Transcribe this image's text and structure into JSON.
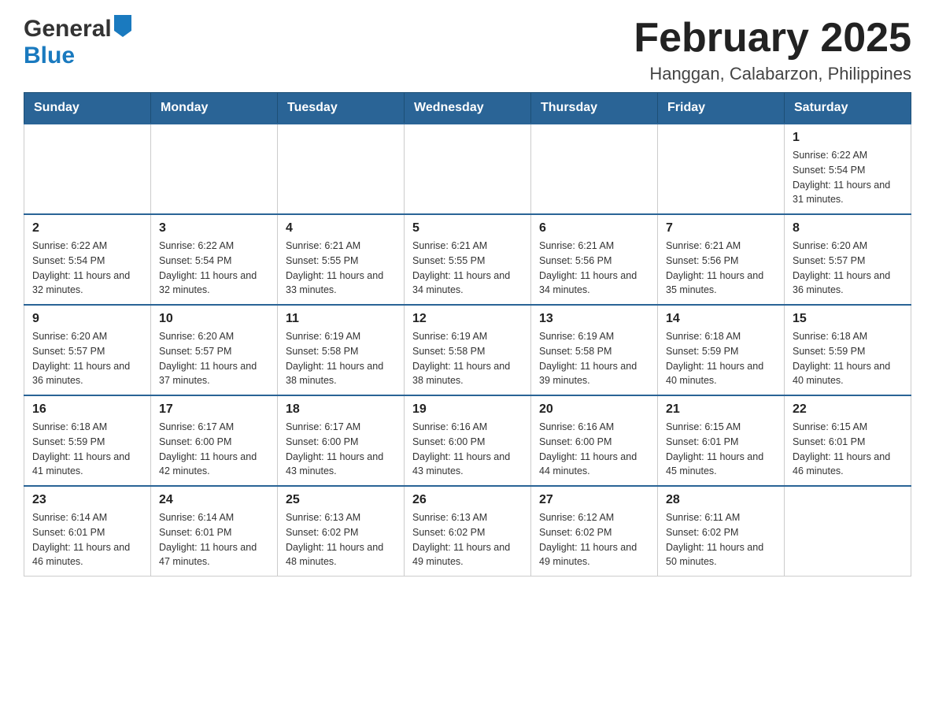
{
  "header": {
    "logo_general": "General",
    "logo_blue": "Blue",
    "month_title": "February 2025",
    "location": "Hanggan, Calabarzon, Philippines"
  },
  "weekdays": [
    "Sunday",
    "Monday",
    "Tuesday",
    "Wednesday",
    "Thursday",
    "Friday",
    "Saturday"
  ],
  "weeks": [
    [
      {
        "day": "",
        "sunrise": "",
        "sunset": "",
        "daylight": ""
      },
      {
        "day": "",
        "sunrise": "",
        "sunset": "",
        "daylight": ""
      },
      {
        "day": "",
        "sunrise": "",
        "sunset": "",
        "daylight": ""
      },
      {
        "day": "",
        "sunrise": "",
        "sunset": "",
        "daylight": ""
      },
      {
        "day": "",
        "sunrise": "",
        "sunset": "",
        "daylight": ""
      },
      {
        "day": "",
        "sunrise": "",
        "sunset": "",
        "daylight": ""
      },
      {
        "day": "1",
        "sunrise": "Sunrise: 6:22 AM",
        "sunset": "Sunset: 5:54 PM",
        "daylight": "Daylight: 11 hours and 31 minutes."
      }
    ],
    [
      {
        "day": "2",
        "sunrise": "Sunrise: 6:22 AM",
        "sunset": "Sunset: 5:54 PM",
        "daylight": "Daylight: 11 hours and 32 minutes."
      },
      {
        "day": "3",
        "sunrise": "Sunrise: 6:22 AM",
        "sunset": "Sunset: 5:54 PM",
        "daylight": "Daylight: 11 hours and 32 minutes."
      },
      {
        "day": "4",
        "sunrise": "Sunrise: 6:21 AM",
        "sunset": "Sunset: 5:55 PM",
        "daylight": "Daylight: 11 hours and 33 minutes."
      },
      {
        "day": "5",
        "sunrise": "Sunrise: 6:21 AM",
        "sunset": "Sunset: 5:55 PM",
        "daylight": "Daylight: 11 hours and 34 minutes."
      },
      {
        "day": "6",
        "sunrise": "Sunrise: 6:21 AM",
        "sunset": "Sunset: 5:56 PM",
        "daylight": "Daylight: 11 hours and 34 minutes."
      },
      {
        "day": "7",
        "sunrise": "Sunrise: 6:21 AM",
        "sunset": "Sunset: 5:56 PM",
        "daylight": "Daylight: 11 hours and 35 minutes."
      },
      {
        "day": "8",
        "sunrise": "Sunrise: 6:20 AM",
        "sunset": "Sunset: 5:57 PM",
        "daylight": "Daylight: 11 hours and 36 minutes."
      }
    ],
    [
      {
        "day": "9",
        "sunrise": "Sunrise: 6:20 AM",
        "sunset": "Sunset: 5:57 PM",
        "daylight": "Daylight: 11 hours and 36 minutes."
      },
      {
        "day": "10",
        "sunrise": "Sunrise: 6:20 AM",
        "sunset": "Sunset: 5:57 PM",
        "daylight": "Daylight: 11 hours and 37 minutes."
      },
      {
        "day": "11",
        "sunrise": "Sunrise: 6:19 AM",
        "sunset": "Sunset: 5:58 PM",
        "daylight": "Daylight: 11 hours and 38 minutes."
      },
      {
        "day": "12",
        "sunrise": "Sunrise: 6:19 AM",
        "sunset": "Sunset: 5:58 PM",
        "daylight": "Daylight: 11 hours and 38 minutes."
      },
      {
        "day": "13",
        "sunrise": "Sunrise: 6:19 AM",
        "sunset": "Sunset: 5:58 PM",
        "daylight": "Daylight: 11 hours and 39 minutes."
      },
      {
        "day": "14",
        "sunrise": "Sunrise: 6:18 AM",
        "sunset": "Sunset: 5:59 PM",
        "daylight": "Daylight: 11 hours and 40 minutes."
      },
      {
        "day": "15",
        "sunrise": "Sunrise: 6:18 AM",
        "sunset": "Sunset: 5:59 PM",
        "daylight": "Daylight: 11 hours and 40 minutes."
      }
    ],
    [
      {
        "day": "16",
        "sunrise": "Sunrise: 6:18 AM",
        "sunset": "Sunset: 5:59 PM",
        "daylight": "Daylight: 11 hours and 41 minutes."
      },
      {
        "day": "17",
        "sunrise": "Sunrise: 6:17 AM",
        "sunset": "Sunset: 6:00 PM",
        "daylight": "Daylight: 11 hours and 42 minutes."
      },
      {
        "day": "18",
        "sunrise": "Sunrise: 6:17 AM",
        "sunset": "Sunset: 6:00 PM",
        "daylight": "Daylight: 11 hours and 43 minutes."
      },
      {
        "day": "19",
        "sunrise": "Sunrise: 6:16 AM",
        "sunset": "Sunset: 6:00 PM",
        "daylight": "Daylight: 11 hours and 43 minutes."
      },
      {
        "day": "20",
        "sunrise": "Sunrise: 6:16 AM",
        "sunset": "Sunset: 6:00 PM",
        "daylight": "Daylight: 11 hours and 44 minutes."
      },
      {
        "day": "21",
        "sunrise": "Sunrise: 6:15 AM",
        "sunset": "Sunset: 6:01 PM",
        "daylight": "Daylight: 11 hours and 45 minutes."
      },
      {
        "day": "22",
        "sunrise": "Sunrise: 6:15 AM",
        "sunset": "Sunset: 6:01 PM",
        "daylight": "Daylight: 11 hours and 46 minutes."
      }
    ],
    [
      {
        "day": "23",
        "sunrise": "Sunrise: 6:14 AM",
        "sunset": "Sunset: 6:01 PM",
        "daylight": "Daylight: 11 hours and 46 minutes."
      },
      {
        "day": "24",
        "sunrise": "Sunrise: 6:14 AM",
        "sunset": "Sunset: 6:01 PM",
        "daylight": "Daylight: 11 hours and 47 minutes."
      },
      {
        "day": "25",
        "sunrise": "Sunrise: 6:13 AM",
        "sunset": "Sunset: 6:02 PM",
        "daylight": "Daylight: 11 hours and 48 minutes."
      },
      {
        "day": "26",
        "sunrise": "Sunrise: 6:13 AM",
        "sunset": "Sunset: 6:02 PM",
        "daylight": "Daylight: 11 hours and 49 minutes."
      },
      {
        "day": "27",
        "sunrise": "Sunrise: 6:12 AM",
        "sunset": "Sunset: 6:02 PM",
        "daylight": "Daylight: 11 hours and 49 minutes."
      },
      {
        "day": "28",
        "sunrise": "Sunrise: 6:11 AM",
        "sunset": "Sunset: 6:02 PM",
        "daylight": "Daylight: 11 hours and 50 minutes."
      },
      {
        "day": "",
        "sunrise": "",
        "sunset": "",
        "daylight": ""
      }
    ]
  ]
}
